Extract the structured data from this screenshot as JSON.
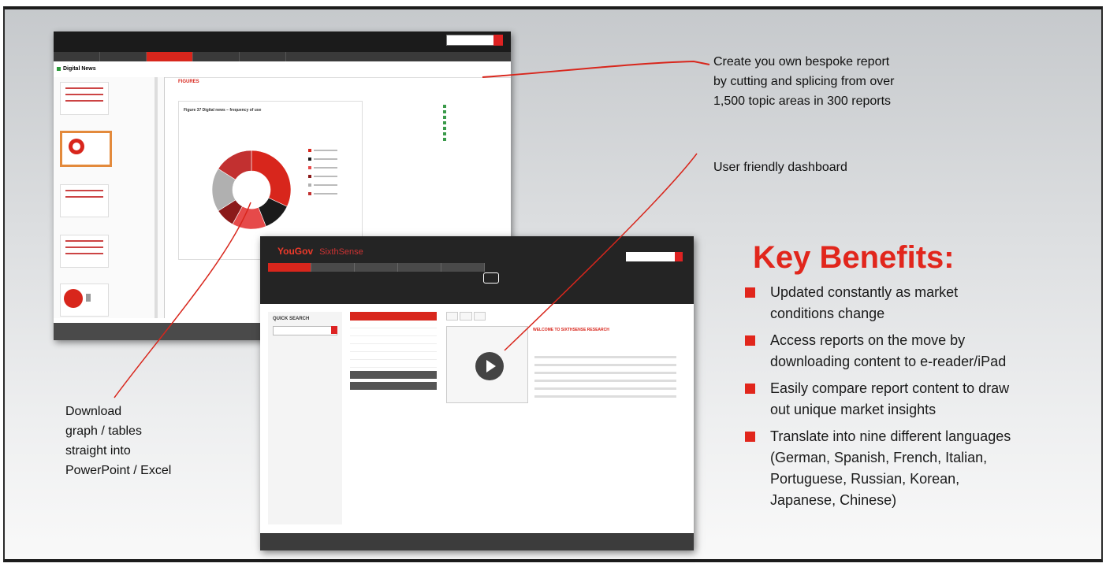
{
  "callouts": {
    "report_line1": "Create you own bespoke report",
    "report_line2": "by cutting and splicing from over",
    "report_line3": "1,500 topic areas in 300 reports",
    "dashboard": "User friendly dashboard",
    "download_line1": "Download",
    "download_line2": "graph / tables",
    "download_line3": "straight into",
    "download_line4": "PowerPoint / Excel"
  },
  "key_benefits": {
    "title": "Key Benefits:",
    "items": [
      {
        "line1": "Updated constantly as market",
        "line2": "conditions change"
      },
      {
        "line1": "Access reports on the move by",
        "line2": "downloading content to e-reader/iPad"
      },
      {
        "line1": "Easily compare report content to draw",
        "line2": "out unique market insights"
      },
      {
        "line1": "Translate into nine different languages",
        "line2": "(German, Spanish, French, Italian,",
        "line3": "Portuguese, Russian, Korean,",
        "line4": "Japanese, Chinese)"
      }
    ]
  },
  "screenshot_report": {
    "title": "Digital News",
    "figures_label": "FIGURES",
    "chart_title": "Figure 37 Digital news – frequency of use",
    "chart_slices": [
      {
        "value": 32,
        "color": "#d8261c"
      },
      {
        "value": 12,
        "color": "#1a1a1a"
      },
      {
        "value": 14,
        "color": "#e64a4a"
      },
      {
        "value": 8,
        "color": "#8b1a1a"
      },
      {
        "value": 18,
        "color": "#b0b0b0"
      },
      {
        "value": 16,
        "color": "#c23030"
      }
    ]
  },
  "screenshot_dashboard": {
    "logo": "YouGov",
    "logo_sub": "SixthSense",
    "quick_search": "QUICK SEARCH",
    "welcome": "WELCOME TO SIXTHSENSE RESEARCH"
  },
  "colors": {
    "accent": "#e1261c",
    "dark": "#242424"
  }
}
